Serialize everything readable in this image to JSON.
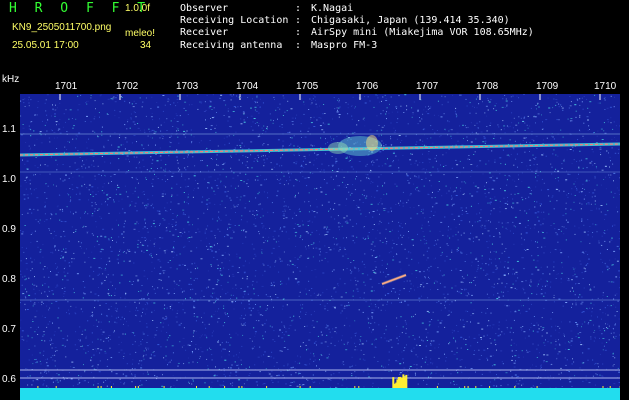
{
  "header": {
    "title": "H R O F F T",
    "version": "1.0.0f",
    "filename": "KN9_2505011700.png",
    "meleo_label": "meleo!",
    "datetime": "25.05.01 17:00",
    "count": "34"
  },
  "info": [
    {
      "key": "Observer",
      "value": "K.Nagai"
    },
    {
      "key": "Receiving Location",
      "value": "Chigasaki, Japan (139.414 35.340)"
    },
    {
      "key": "Receiver",
      "value": "AirSpy mini (Miakejima VOR 108.65MHz)"
    },
    {
      "key": "Receiving antenna",
      "value": "Maspro FM-3"
    }
  ],
  "axes": {
    "y_unit": "kHz",
    "y_ticks": [
      "1.1",
      "1.0",
      "0.9",
      "0.8",
      "0.7",
      "0.6"
    ],
    "x_ticks": [
      "1701",
      "1702",
      "1703",
      "1704",
      "1705",
      "1706",
      "1707",
      "1708",
      "1709",
      "1710"
    ]
  },
  "colors": {
    "background": "#000000",
    "plot_noise_base": "#14219c",
    "carrier": "#ff6666",
    "title": "#33ff33",
    "meta": "#ffff66",
    "bottom_band": "#22ddee"
  }
}
